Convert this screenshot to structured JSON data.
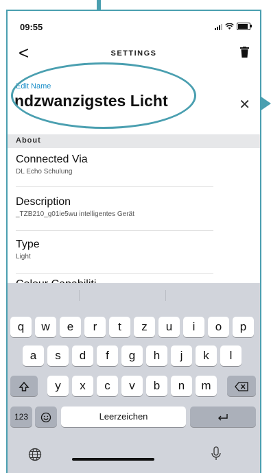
{
  "status_bar": {
    "time": "09:55"
  },
  "nav": {
    "back_glyph": "<",
    "title": "SETTINGS"
  },
  "edit": {
    "label": "Edit Name",
    "value": "ndzwanzigstes Licht",
    "clear_glyph": "✕"
  },
  "section": {
    "header": "About"
  },
  "rows": [
    {
      "title": "Connected Via",
      "sub": "DL Echo Schulung"
    },
    {
      "title": "Description",
      "sub": "_TZB210_g01ie5wu intelligentes Gerät"
    },
    {
      "title": "Type",
      "sub": "Light"
    },
    {
      "title": "Colour Capabiliti"
    }
  ],
  "keyboard": {
    "row1": [
      "q",
      "w",
      "e",
      "r",
      "t",
      "z",
      "u",
      "i",
      "o",
      "p"
    ],
    "row2": [
      "a",
      "s",
      "d",
      "f",
      "g",
      "h",
      "j",
      "k",
      "l"
    ],
    "row3": [
      "y",
      "x",
      "c",
      "v",
      "b",
      "n",
      "m"
    ],
    "numbers": "123",
    "space": "Leerzeichen"
  },
  "colors": {
    "accent": "#4a9fb0",
    "link": "#1a8ec9"
  }
}
